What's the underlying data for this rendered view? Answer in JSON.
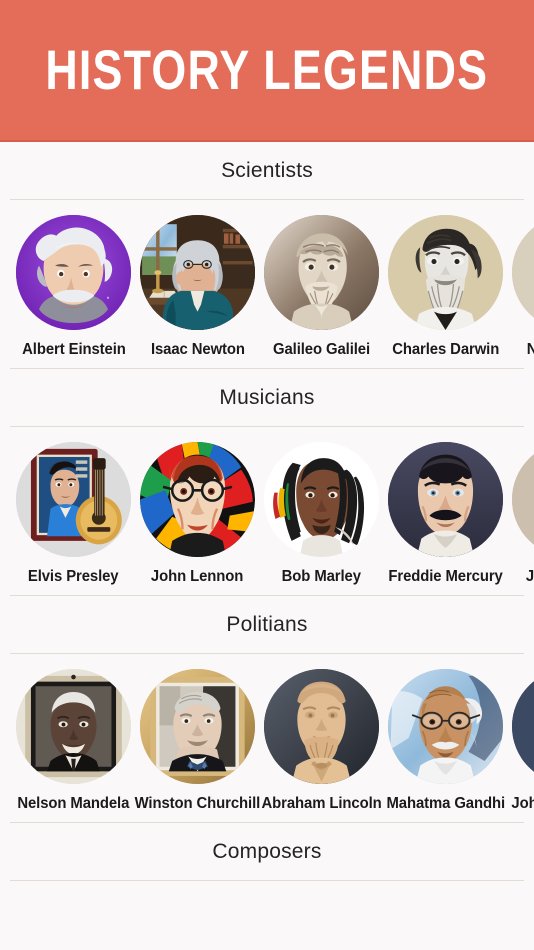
{
  "header": {
    "title": "HISTORY LEGENDS",
    "bg_color": "#E46D59",
    "text_color": "#FFFFFF"
  },
  "page": {
    "background_color": "#FBF8FA",
    "divider_color": "#E4DBD5"
  },
  "sections": [
    {
      "title": "Scientists",
      "people": [
        {
          "name": "Albert Einstein",
          "art": "einstein"
        },
        {
          "name": "Isaac Newton",
          "art": "newton"
        },
        {
          "name": "Galileo Galilei",
          "art": "galileo"
        },
        {
          "name": "Charles Darwin",
          "art": "darwin"
        },
        {
          "name": "Nikola Tesla",
          "art": "tesla"
        }
      ]
    },
    {
      "title": "Musicians",
      "people": [
        {
          "name": "Elvis Presley",
          "art": "elvis"
        },
        {
          "name": "John Lennon",
          "art": "lennon"
        },
        {
          "name": "Bob Marley",
          "art": "marley"
        },
        {
          "name": "Freddie Mercury",
          "art": "mercury"
        },
        {
          "name": "Jimi Hendrix",
          "art": "hendrix"
        }
      ]
    },
    {
      "title": "Politians",
      "people": [
        {
          "name": "Nelson Mandela",
          "art": "mandela"
        },
        {
          "name": "Winston Churchill",
          "art": "churchill"
        },
        {
          "name": "Abraham Lincoln",
          "art": "lincoln"
        },
        {
          "name": "Mahatma Gandhi",
          "art": "gandhi"
        },
        {
          "name": "John F. Kennedy",
          "art": "kennedy"
        }
      ]
    },
    {
      "title": "Composers",
      "people": []
    }
  ]
}
